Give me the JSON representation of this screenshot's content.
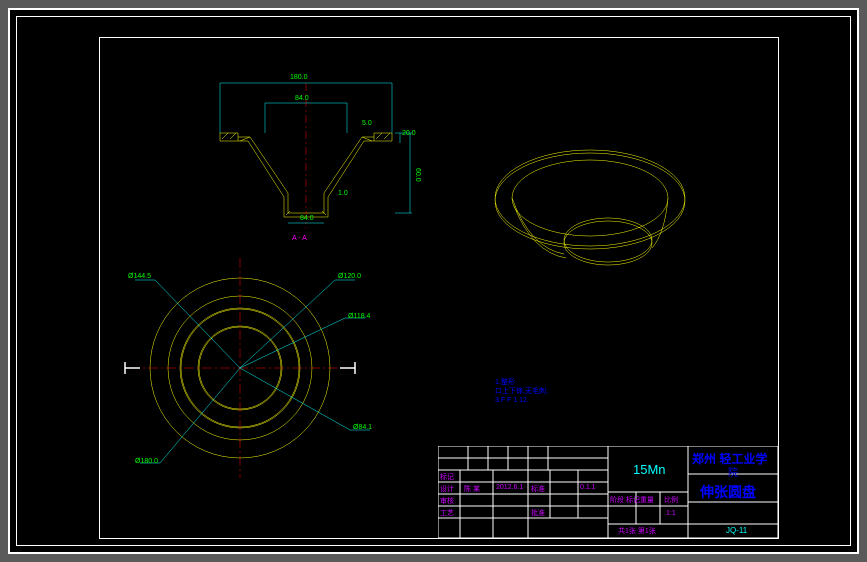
{
  "drawing": {
    "top_view": {
      "dim_outer_width": "180.0",
      "dim_inner_width": "84.0",
      "dim_bottom_width": "84.0",
      "dim_height_outer": "60.0",
      "dim_height_step": "20.0",
      "dim_step2": "5.0",
      "dim_thickness": "1.0"
    },
    "section_label": "A - A",
    "front_view": {
      "dim_d1": "Ø144.5",
      "dim_d2": "Ø120.0",
      "dim_d3": "Ø118.4",
      "dim_d4": "Ø84.1",
      "dim_d5": "Ø180.0"
    },
    "notes": {
      "line1": "1.整形",
      "line2": "口上下锋,无毛刺;",
      "line3": "3.F F 1 12."
    },
    "titleblock": {
      "material": "15Mn",
      "school": "郑州 轻工业学",
      "school2": "院",
      "part_name": "伸张圆盘",
      "dwg_no": "JQ-11",
      "row_labels": {
        "r1c1": "标记",
        "r1c2": "",
        "r1c3": "",
        "r1c4": "",
        "r1c5": "",
        "r2c1": "设计",
        "r2c2": "陈 某",
        "r2c3": "2012.6.1",
        "r2c4": "标准",
        "r2c5": "",
        "r3c1": "审核",
        "r3c2": "",
        "r3c3": "",
        "r3c4": "",
        "r3c5": "",
        "r4c1": "工艺",
        "r4c2": "",
        "r4c3": "",
        "r4c4": "批准",
        "r4c5": "",
        "stage": "阶段 标记",
        "weight": "重量",
        "scale": "比例",
        "sheet": "共1张 第1张",
        "scale_val": "1:1",
        "tol": "0.1.1"
      }
    }
  }
}
